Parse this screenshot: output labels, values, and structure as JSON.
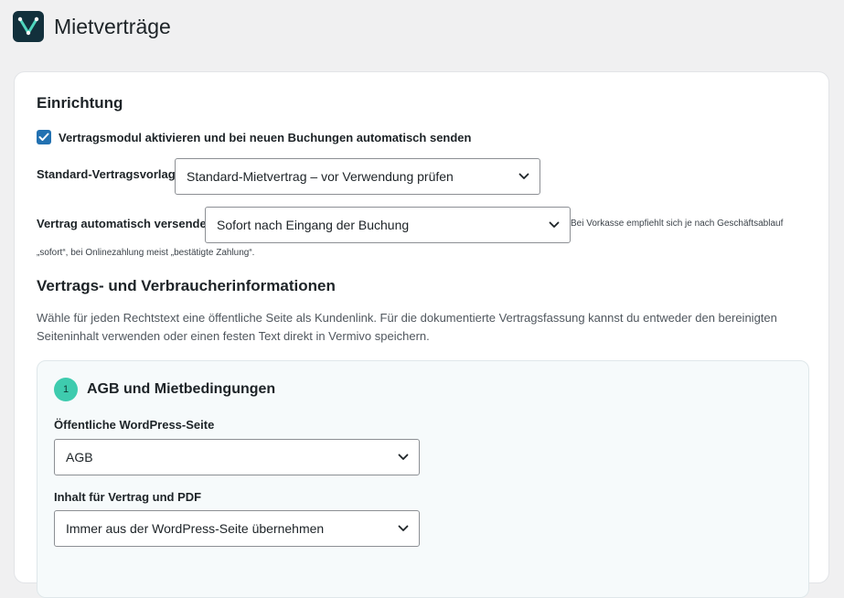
{
  "header": {
    "title": "Mietverträge",
    "logo_icon": "vermivo-logo-icon"
  },
  "setup": {
    "heading": "Einrichtung",
    "activate_checkbox": {
      "label": "Vertragsmodul aktivieren und bei neuen Buchungen automatisch senden",
      "checked": true
    },
    "template": {
      "label": "Standard-Vertragsvorlage",
      "value": "Standard-Mietvertrag – vor Verwendung prüfen"
    },
    "auto_send": {
      "label": "Vertrag automatisch versenden",
      "value": "Sofort nach Eingang der Buchung",
      "hint_line1": "Bei Vorkasse empfiehlt sich je nach Geschäftsablauf",
      "hint_line2": "„sofort“, bei Onlinezahlung meist „bestätigte Zahlung“."
    }
  },
  "consumer_info": {
    "heading": "Vertrags- und Verbraucherinformationen",
    "description_line1": "Wähle für jeden Rechtstext eine öffentliche Seite als Kundenlink. Für die dokumentierte Vertragsfassung kannst du entweder den bereinigten",
    "description_line2": "Seiteninhalt verwenden oder einen festen Text direkt in Vermivo speichern.",
    "sections": [
      {
        "number": "1",
        "title": "AGB und Mietbedingungen",
        "page_label": "Öffentliche WordPress-Seite",
        "page_value": "AGB",
        "content_label": "Inhalt für Vertrag und PDF",
        "content_value": "Immer aus der WordPress-Seite übernehmen"
      }
    ]
  },
  "colors": {
    "accent": "#2271b1",
    "badge": "#3ecbae",
    "logo_bg": "#12303c"
  }
}
